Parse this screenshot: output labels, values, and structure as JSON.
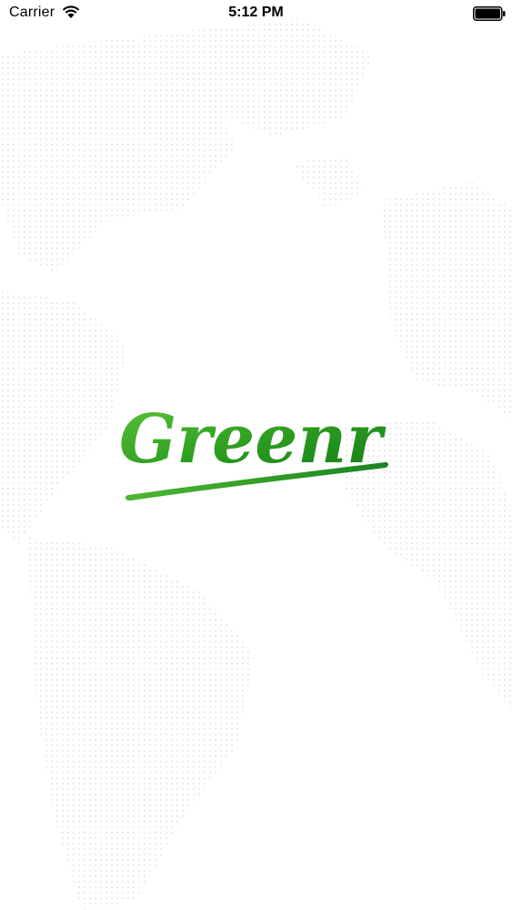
{
  "status_bar": {
    "carrier": "Carrier",
    "time": "5:12 PM",
    "icons": [
      "wifi-icon",
      "battery-icon"
    ]
  },
  "logo": {
    "text": "Greenr",
    "colors": [
      "#5cc43a",
      "#2a9a1f",
      "#137a18"
    ]
  }
}
